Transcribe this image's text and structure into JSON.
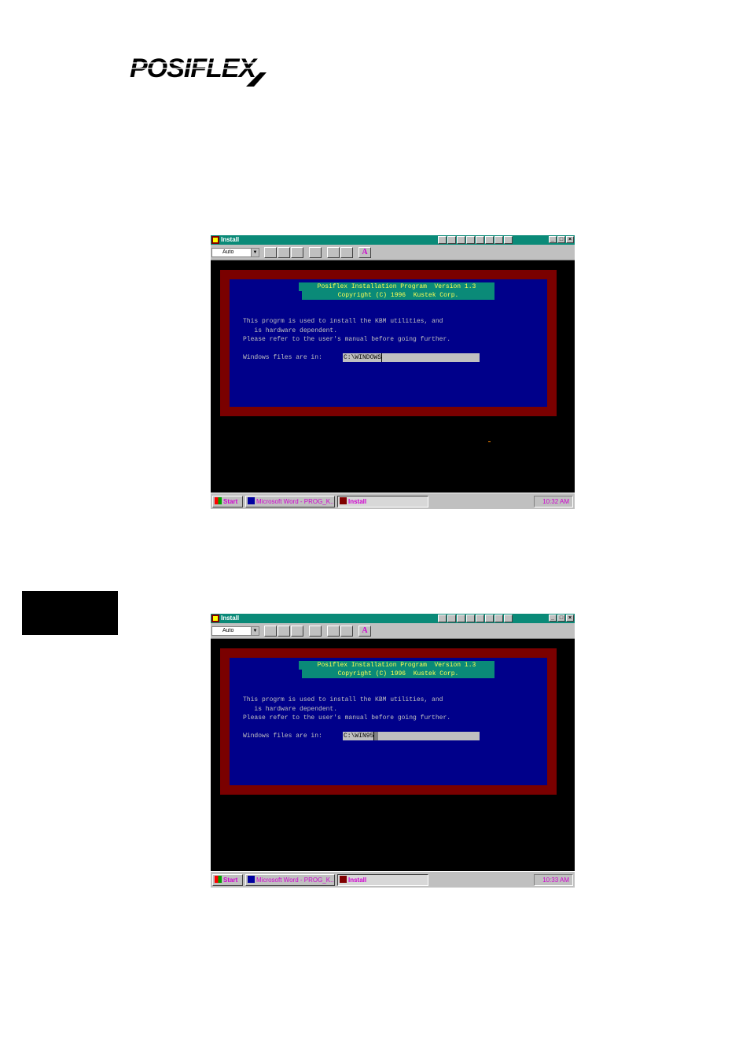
{
  "logo": {
    "text": "POSIFLEX"
  },
  "screens": [
    {
      "window_title": "Install",
      "font_select": "Auto",
      "toolbar_icons": [
        "mark-icon",
        "copy-icon",
        "paste-icon",
        "fullscreen-icon",
        "properties-icon",
        "background-icon",
        "font-icon"
      ],
      "dialog": {
        "header_line1": "Posiflex Installation Program  Version 1.3",
        "header_line2": "Copyright (C) 1996  Kustek Corp.",
        "body_line1": "This progrm is used to install the KBM utilities, and",
        "body_line2": "   is hardware dependent.",
        "body_line3": "Please refer to the user's manual before going further.",
        "prompt_label": "Windows files are in:",
        "prompt_value": "C:\\WINDOWS"
      },
      "taskbar": {
        "start_label": "Start",
        "word_task_label": "Microsoft Word - PROG_K...",
        "install_task_label": "Install",
        "clock": "10:32 AM"
      }
    },
    {
      "window_title": "Install",
      "font_select": "Auto",
      "toolbar_icons": [
        "mark-icon",
        "copy-icon",
        "paste-icon",
        "fullscreen-icon",
        "properties-icon",
        "background-icon",
        "font-icon"
      ],
      "dialog": {
        "header_line1": "Posiflex Installation Program  Version 1.3",
        "header_line2": "Copyright (C) 1996  Kustek Corp.",
        "body_line1": "This progrm is used to install the KBM utilities, and",
        "body_line2": "   is hardware dependent.",
        "body_line3": "Please refer to the user's manual before going further.",
        "prompt_label": "Windows files are in:",
        "prompt_value": "C:\\WIN95"
      },
      "taskbar": {
        "start_label": "Start",
        "word_task_label": "Microsoft Word - PROG_K...",
        "install_task_label": "Install",
        "clock": "10:33 AM"
      }
    }
  ],
  "colors": {
    "console_bg": "#000000",
    "dialog_border": "#7a0000",
    "dialog_bg": "#00008a",
    "header_bg": "#0a8a78",
    "header_text": "#ffff55",
    "body_text": "#c0c0c0",
    "taskbar_text": "#d000d0"
  }
}
